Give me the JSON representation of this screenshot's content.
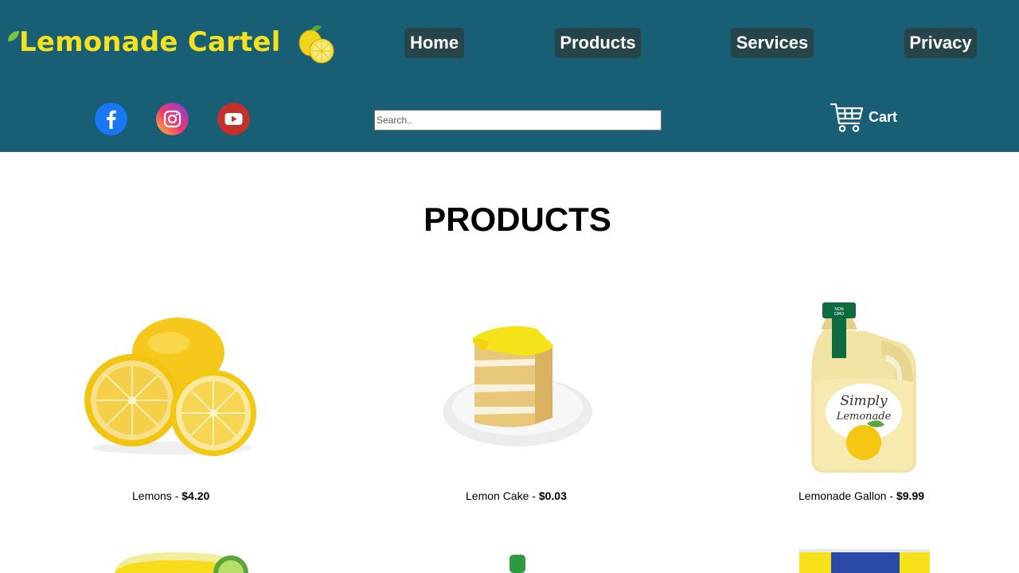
{
  "brand": {
    "name": "Lemonade Cartel"
  },
  "nav": [
    {
      "label": "Home"
    },
    {
      "label": "Products"
    },
    {
      "label": "Services"
    },
    {
      "label": "Privacy"
    }
  ],
  "social": [
    {
      "icon": "facebook-icon",
      "color": "#1877f2"
    },
    {
      "icon": "instagram-icon",
      "color": "#e1306c"
    },
    {
      "icon": "youtube-icon",
      "color": "#c4302b"
    }
  ],
  "search": {
    "placeholder": "Search..",
    "value": ""
  },
  "cart": {
    "label": "Cart",
    "icon": "shopping-cart-icon"
  },
  "page_title": "PRODUCTS",
  "products": [
    {
      "name": "Lemons",
      "price": "$4.20",
      "icon": "lemons-image"
    },
    {
      "name": "Lemon Cake",
      "price": "$0.03",
      "icon": "lemon-cake-image"
    },
    {
      "name": "Lemonade Gallon",
      "price": "$9.99",
      "icon": "lemonade-gallon-image"
    }
  ],
  "colors": {
    "header": "#185e74",
    "nav_button": "#27444a",
    "logo_text": "#f5e11d"
  }
}
